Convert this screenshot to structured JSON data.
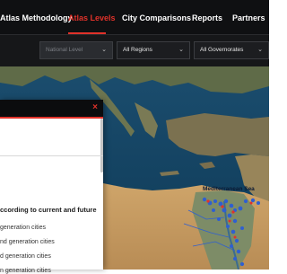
{
  "nav": {
    "items": [
      {
        "label": "Atlas Methodology"
      },
      {
        "label": "Atlas Levels"
      },
      {
        "label": "City Comparisons"
      },
      {
        "label": "Reports"
      },
      {
        "label": "Partners"
      }
    ],
    "active_color": "#e0322a"
  },
  "filters": {
    "level": {
      "value": "National Level"
    },
    "region": {
      "value": "All Regions"
    },
    "governorate": {
      "value": "All Governorates"
    }
  },
  "map": {
    "sea_label": "Mediterranean Sea"
  },
  "panel": {
    "close_icon": "×",
    "heading": "ccording to current and future",
    "legend": [
      {
        "label": "generation cities"
      },
      {
        "label": "nd generation cities"
      },
      {
        "label": "d generation cities"
      },
      {
        "label": "n generation cities"
      }
    ]
  },
  "icons": {
    "chevron": "chevron-down-icon",
    "close": "close-icon"
  }
}
